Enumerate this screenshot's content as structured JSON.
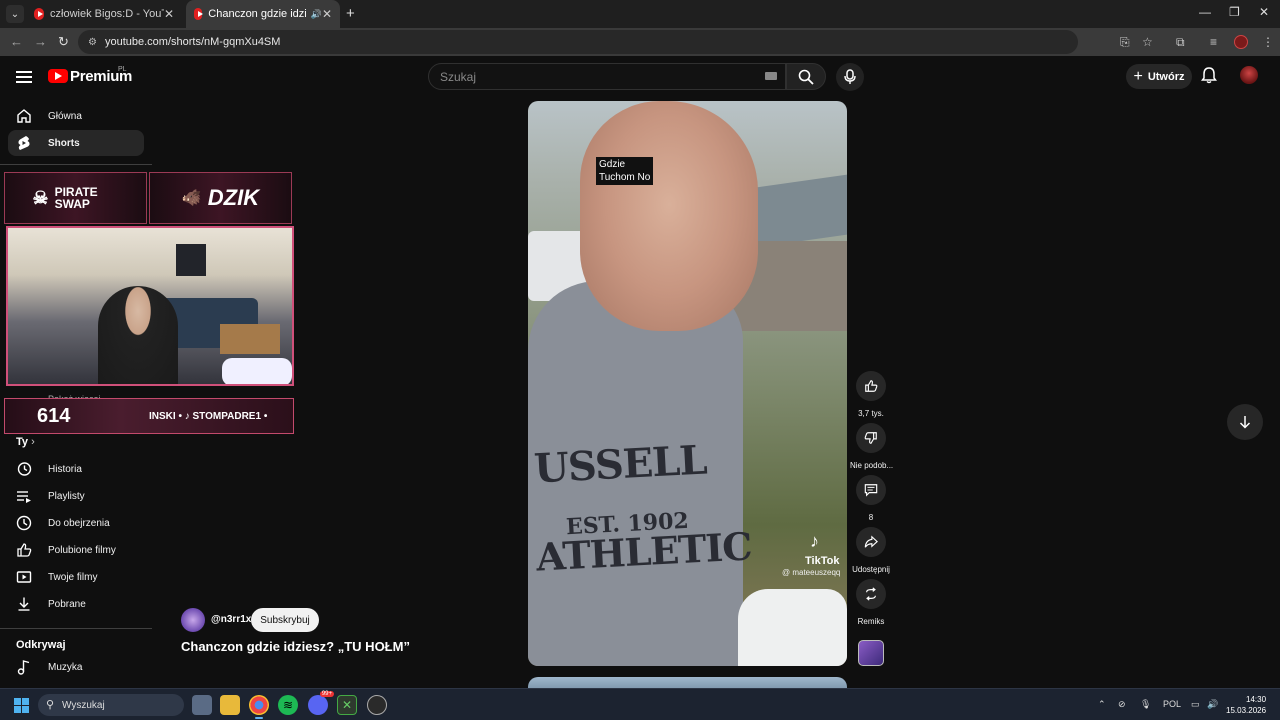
{
  "browser": {
    "tabs": [
      {
        "title": "człowiek Bigos:D - YouTube",
        "active": false
      },
      {
        "title": "Chanczon gdzie idziesz? „TU",
        "active": true
      }
    ],
    "url": "youtube.com/shorts/nM-gqmXu4SM",
    "icons": [
      "tab-search-icon",
      "back-icon",
      "forward-icon",
      "reload-icon",
      "site-info-icon",
      "install-icon",
      "star-icon",
      "extensions-icon",
      "reading-list-icon",
      "profile-icon",
      "menu-icon",
      "minimize-icon",
      "maximize-icon",
      "close-icon"
    ]
  },
  "header": {
    "logo_text": "Premium",
    "country": "PL",
    "search_placeholder": "Szukaj",
    "create_label": "Utwórz"
  },
  "sidebar": {
    "items": [
      {
        "label": "Główna",
        "icon": "home-icon"
      },
      {
        "label": "Shorts",
        "icon": "shorts-icon",
        "active": true
      }
    ],
    "more_label": "Pokaż więcej",
    "you_heading": "Ty",
    "you_items": [
      {
        "label": "Historia",
        "icon": "history-icon"
      },
      {
        "label": "Playlisty",
        "icon": "playlist-icon"
      },
      {
        "label": "Do obejrzenia",
        "icon": "watch-later-icon"
      },
      {
        "label": "Polubione filmy",
        "icon": "like-icon"
      },
      {
        "label": "Twoje filmy",
        "icon": "your-videos-icon"
      },
      {
        "label": "Pobrane",
        "icon": "download-icon"
      }
    ],
    "explore_heading": "Odkrywaj",
    "explore_items": [
      {
        "label": "Muzyka",
        "icon": "music-icon"
      }
    ]
  },
  "overlay": {
    "brand_left": "PIRATE SWAP",
    "brand_right": "DZIK",
    "count": "614",
    "ticker": "INSKI • ♪ STOMPADRE1 •"
  },
  "video": {
    "caption_line1": "Gdzie",
    "caption_line2": "Tuchom No",
    "shirt_line1": "USSELL",
    "shirt_line2": "EST. 1902",
    "shirt_line3": "ATHLETIC",
    "tiktok_brand": "TikTok",
    "tiktok_user": "@ mateeuszeqq"
  },
  "actions": {
    "like_count": "3,7 tys.",
    "dislike_label": "Nie podob...",
    "comment_count": "8",
    "share_label": "Udostępnij",
    "remix_label": "Remiks"
  },
  "short_info": {
    "channel": "@n3rr1x",
    "subscribe_label": "Subskrybuj",
    "title": "Chanczon gdzie idziesz? „TU HOŁM”"
  },
  "taskbar": {
    "search_label": "Wyszukaj",
    "badge": "99+",
    "lang": "POL",
    "time": "14:30",
    "date": "15.03.2026"
  }
}
